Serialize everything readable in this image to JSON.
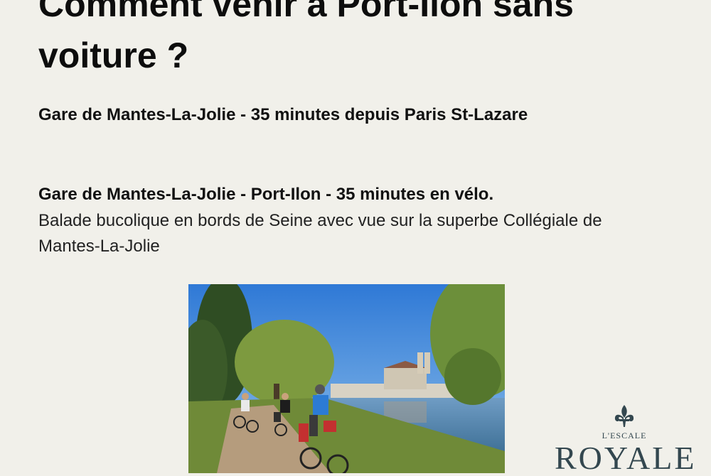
{
  "title": "Comment venir à Port-Ilon sans voiture ?",
  "train_line": "Gare de Mantes-La-Jolie - 35 minutes depuis Paris St-Lazare",
  "bike_line": "Gare de Mantes-La-Jolie - Port-Ilon - 35 minutes en vélo.",
  "bike_description": "Balade bucolique en bords de Seine avec vue sur la superbe Collégiale de Mantes-La-Jolie",
  "photo": {
    "icon": "cyclists-riverside-photo"
  },
  "logo": {
    "icon": "fleur-de-lis-icon",
    "top_text": "L'ESCALE",
    "main_text": "ROYALE",
    "color": "#33474f"
  },
  "colors": {
    "background": "#f1f0ea",
    "text": "#111111"
  }
}
